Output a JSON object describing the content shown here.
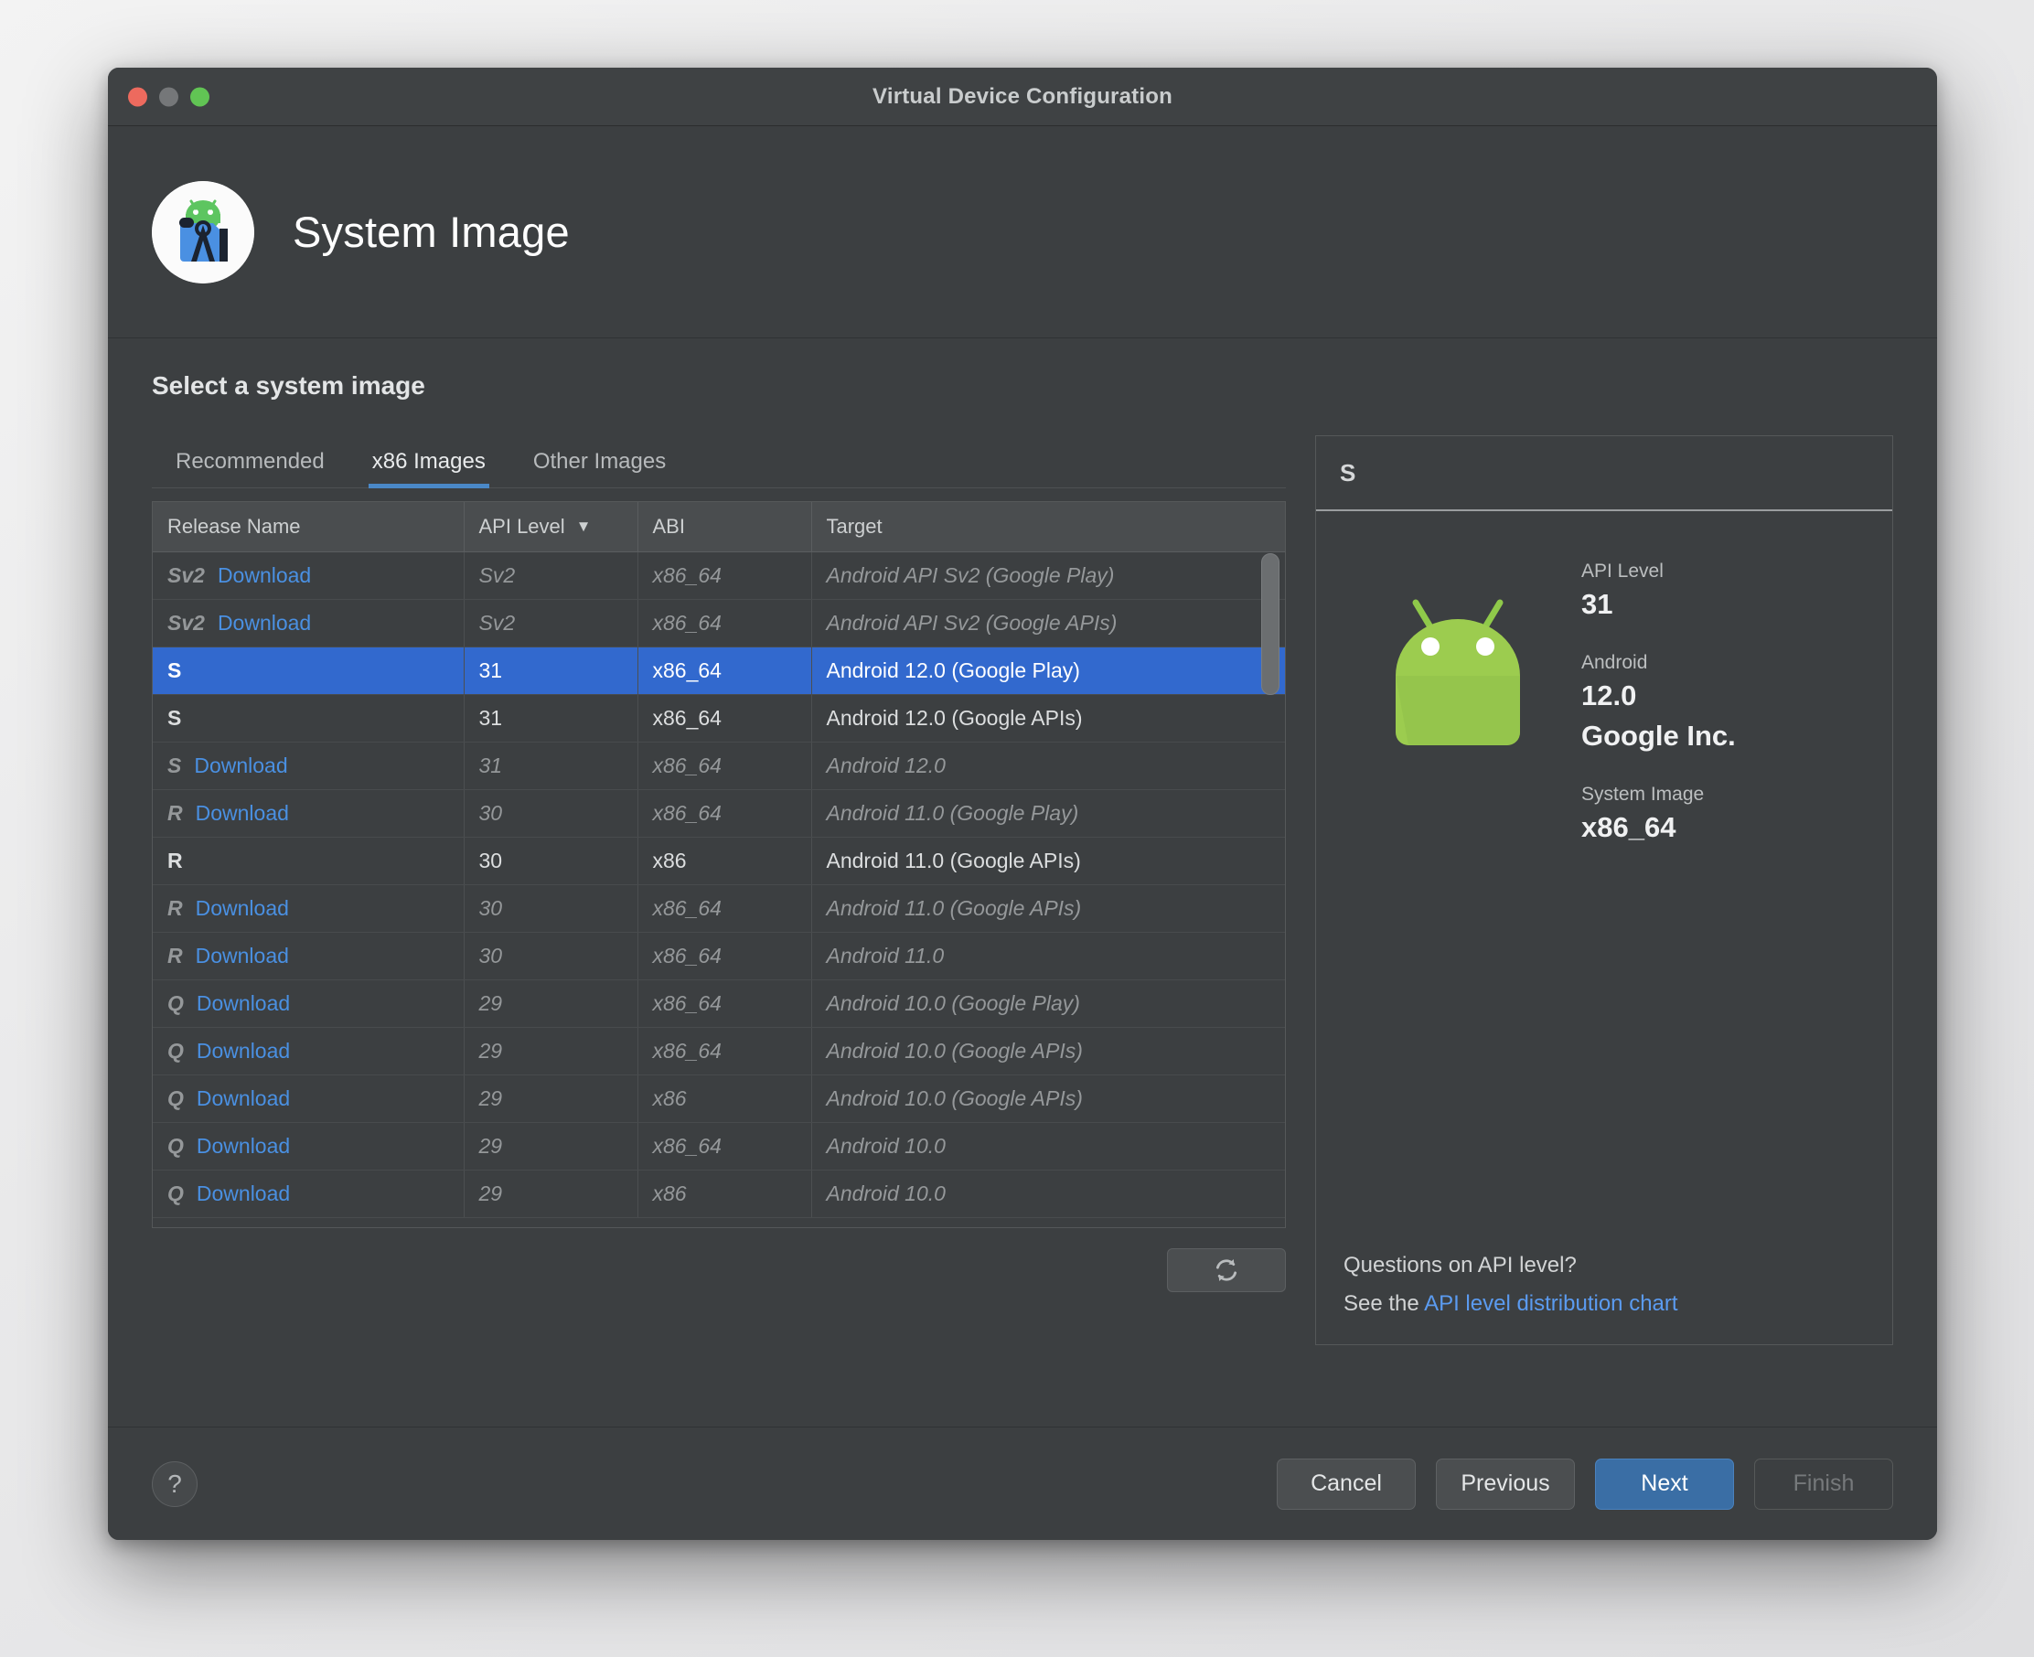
{
  "window": {
    "title": "Virtual Device Configuration",
    "traffic_lights": [
      "close",
      "minimize",
      "maximize"
    ]
  },
  "wizard": {
    "title": "System Image",
    "logo_icon": "android-studio-icon"
  },
  "main": {
    "section_title": "Select a system image",
    "tabs": [
      {
        "label": "Recommended",
        "active": false
      },
      {
        "label": "x86 Images",
        "active": true
      },
      {
        "label": "Other Images",
        "active": false
      }
    ],
    "table": {
      "columns": [
        "Release Name",
        "API Level",
        "ABI",
        "Target"
      ],
      "sorted_column": "API Level",
      "sort_direction": "desc",
      "sort_caret": "▼",
      "download_label": "Download",
      "rows": [
        {
          "release": "Sv2",
          "download": true,
          "api": "Sv2",
          "abi": "x86_64",
          "target": "Android API Sv2 (Google Play)",
          "state": "downloadable"
        },
        {
          "release": "Sv2",
          "download": true,
          "api": "Sv2",
          "abi": "x86_64",
          "target": "Android API Sv2 (Google APIs)",
          "state": "downloadable"
        },
        {
          "release": "S",
          "download": false,
          "api": "31",
          "abi": "x86_64",
          "target": "Android 12.0 (Google Play)",
          "state": "selected"
        },
        {
          "release": "S",
          "download": false,
          "api": "31",
          "abi": "x86_64",
          "target": "Android 12.0 (Google APIs)",
          "state": "installed"
        },
        {
          "release": "S",
          "download": true,
          "api": "31",
          "abi": "x86_64",
          "target": "Android 12.0",
          "state": "downloadable"
        },
        {
          "release": "R",
          "download": true,
          "api": "30",
          "abi": "x86_64",
          "target": "Android 11.0 (Google Play)",
          "state": "downloadable"
        },
        {
          "release": "R",
          "download": false,
          "api": "30",
          "abi": "x86",
          "target": "Android 11.0 (Google APIs)",
          "state": "installed"
        },
        {
          "release": "R",
          "download": true,
          "api": "30",
          "abi": "x86_64",
          "target": "Android 11.0 (Google APIs)",
          "state": "downloadable"
        },
        {
          "release": "R",
          "download": true,
          "api": "30",
          "abi": "x86_64",
          "target": "Android 11.0",
          "state": "downloadable"
        },
        {
          "release": "Q",
          "download": true,
          "api": "29",
          "abi": "x86_64",
          "target": "Android 10.0 (Google Play)",
          "state": "downloadable"
        },
        {
          "release": "Q",
          "download": true,
          "api": "29",
          "abi": "x86_64",
          "target": "Android 10.0 (Google APIs)",
          "state": "downloadable"
        },
        {
          "release": "Q",
          "download": true,
          "api": "29",
          "abi": "x86",
          "target": "Android 10.0 (Google APIs)",
          "state": "downloadable"
        },
        {
          "release": "Q",
          "download": true,
          "api": "29",
          "abi": "x86_64",
          "target": "Android 10.0",
          "state": "downloadable"
        },
        {
          "release": "Q",
          "download": true,
          "api": "29",
          "abi": "x86",
          "target": "Android 10.0",
          "state": "downloadable"
        }
      ]
    },
    "refresh_icon": "refresh-icon"
  },
  "detail": {
    "header": "S",
    "droid_icon": "android-robot-icon",
    "fields": [
      {
        "label": "API Level",
        "value": "31"
      },
      {
        "label": "Android",
        "value": "12.0"
      },
      {
        "label": "",
        "value": "Google Inc."
      },
      {
        "label": "System Image",
        "value": "x86_64"
      }
    ],
    "question": "Questions on API level?",
    "see_the": "See the",
    "chart_link": "API level distribution chart"
  },
  "footer": {
    "help_label": "?",
    "buttons": [
      {
        "label": "Cancel",
        "style": "normal"
      },
      {
        "label": "Previous",
        "style": "normal"
      },
      {
        "label": "Next",
        "style": "primary"
      },
      {
        "label": "Finish",
        "style": "disabled"
      }
    ]
  },
  "colors": {
    "selection_blue": "#3269ce",
    "accent_blue": "#4a88c7",
    "link_blue": "#4a90e2",
    "android_green": "#8fc94a",
    "window_bg": "#3c3f41"
  }
}
